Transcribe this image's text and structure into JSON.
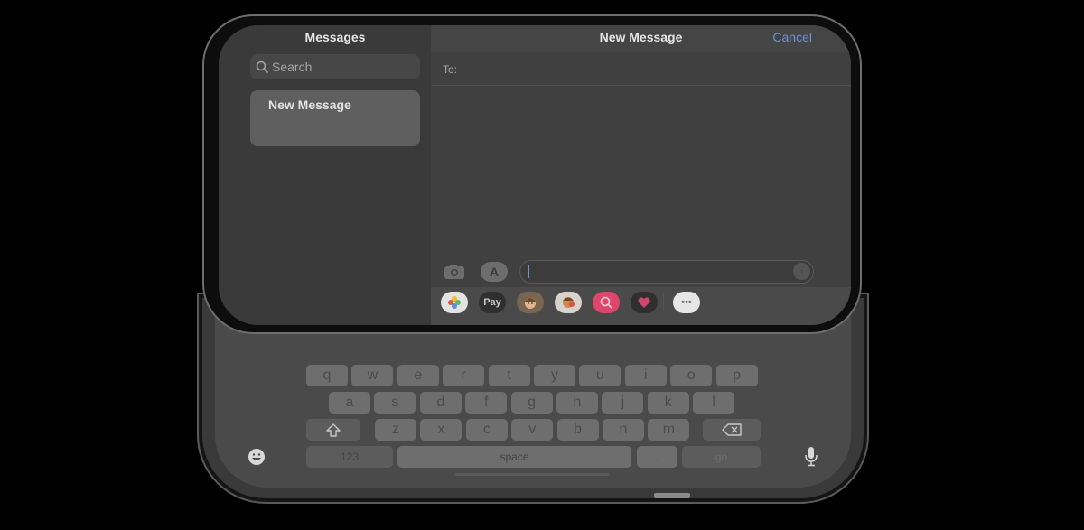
{
  "sidebar": {
    "title": "Messages",
    "search_placeholder": "Search",
    "search_icon": "magnifying-glass-icon",
    "conversations": [
      {
        "title": "New Message",
        "selected": true
      }
    ]
  },
  "main": {
    "title": "New Message",
    "cancel_label": "Cancel",
    "to_label": "To:",
    "message_input_value": "",
    "icons": {
      "camera": "camera-icon",
      "apps": "app-store-icon",
      "send": "arrow-up-icon"
    }
  },
  "app_strip": [
    {
      "name": "Photos",
      "icon": "photos-icon",
      "label": ""
    },
    {
      "name": "Apple Pay",
      "icon": "apple-pay-icon",
      "label": "Pay"
    },
    {
      "name": "Memoji Stickers",
      "icon": "memoji-icon",
      "label": ""
    },
    {
      "name": "Animoji",
      "icon": "animoji-icon",
      "label": ""
    },
    {
      "name": "Image Search",
      "icon": "search-images-icon",
      "label": ""
    },
    {
      "name": "Digital Touch",
      "icon": "heart-icon",
      "label": ""
    },
    {
      "name": "More",
      "icon": "ellipsis-icon",
      "label": "•••"
    }
  ],
  "keyboard": {
    "row1": [
      "q",
      "w",
      "e",
      "r",
      "t",
      "y",
      "u",
      "i",
      "o",
      "p"
    ],
    "row2": [
      "a",
      "s",
      "d",
      "f",
      "g",
      "h",
      "j",
      "k",
      "l"
    ],
    "row3": [
      "z",
      "x",
      "c",
      "v",
      "b",
      "n",
      "m"
    ],
    "shift_icon": "shift-icon",
    "delete_icon": "delete-icon",
    "numbers_label": "123",
    "space_label": "space",
    "period_label": ".",
    "go_label": "go",
    "emoji_icon": "emoji-icon",
    "mic_icon": "microphone-icon"
  }
}
